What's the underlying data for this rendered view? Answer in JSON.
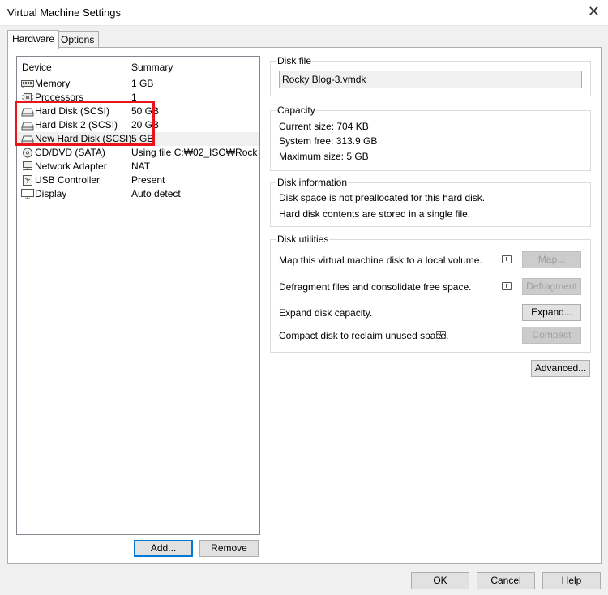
{
  "window": {
    "title": "Virtual Machine Settings",
    "close_glyph": "✕"
  },
  "tabs": [
    {
      "label": "Hardware"
    },
    {
      "label": "Options"
    }
  ],
  "device_list": {
    "columns": {
      "device": "Device",
      "summary": "Summary"
    },
    "rows": [
      {
        "name": "Memory",
        "summary": "1 GB",
        "icon": "memory-icon"
      },
      {
        "name": "Processors",
        "summary": "1",
        "icon": "processor-icon"
      },
      {
        "name": "Hard Disk (SCSI)",
        "summary": "50 GB",
        "icon": "hard-disk-icon"
      },
      {
        "name": "Hard Disk 2 (SCSI)",
        "summary": "20 GB",
        "icon": "hard-disk-icon"
      },
      {
        "name": "New Hard Disk (SCSI)",
        "summary": "5 GB",
        "icon": "hard-disk-icon",
        "selected": true
      },
      {
        "name": "CD/DVD (SATA)",
        "summary": "Using file C:₩02_ISO₩Rock...",
        "icon": "cd-dvd-icon"
      },
      {
        "name": "Network Adapter",
        "summary": "NAT",
        "icon": "network-adapter-icon"
      },
      {
        "name": "USB Controller",
        "summary": "Present",
        "icon": "usb-controller-icon"
      },
      {
        "name": "Display",
        "summary": "Auto detect",
        "icon": "display-icon"
      }
    ]
  },
  "list_buttons": {
    "add": "Add...",
    "remove": "Remove"
  },
  "disk_file": {
    "legend": "Disk file",
    "value": "Rocky Blog-3.vmdk"
  },
  "capacity": {
    "legend": "Capacity",
    "current": "Current size:  704 KB",
    "free": "System free:  313.9 GB",
    "maximum": "Maximum size:  5 GB"
  },
  "disk_information": {
    "legend": "Disk information",
    "line1": "Disk space is not preallocated for this hard disk.",
    "line2": "Hard disk contents are stored in a single file."
  },
  "disk_utilities": {
    "legend": "Disk utilities",
    "map_text": "Map this virtual machine disk to a local volume.",
    "map_button": "Map...",
    "defrag_text": "Defragment files and consolidate free space.",
    "defrag_button": "Defragment",
    "expand_text": "Expand disk capacity.",
    "expand_button": "Expand...",
    "compact_text": "Compact disk to reclaim unused space.",
    "compact_button": "Compact"
  },
  "advanced_button": "Advanced...",
  "footer": {
    "ok": "OK",
    "cancel": "Cancel",
    "help": "Help"
  }
}
